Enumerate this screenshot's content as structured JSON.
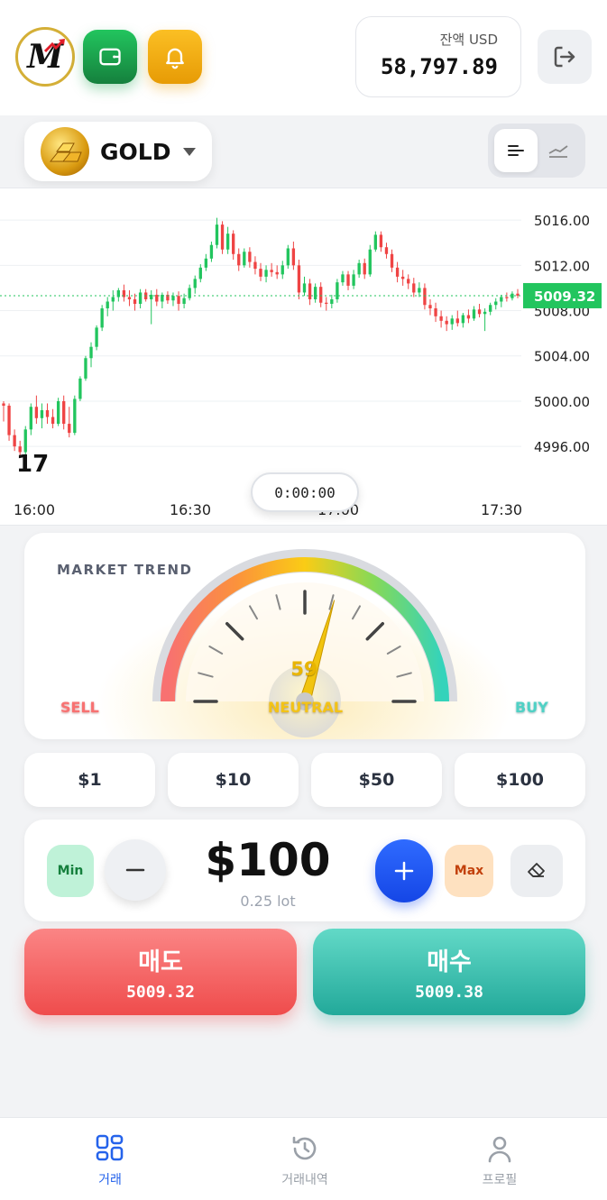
{
  "header": {
    "logo_letter": "M",
    "wallet_icon": "wallet-icon",
    "bell_icon": "bell-icon",
    "balance_label": "잔액 USD",
    "balance_value": "58,797.89",
    "logout_icon": "logout-icon"
  },
  "symbol": {
    "name": "GOLD",
    "icon": "gold-bars-icon"
  },
  "chart_data": {
    "type": "candlestick",
    "xlabels": [
      "16:00",
      "16:30",
      "17:00",
      "17:30"
    ],
    "yticks": [
      "5016.00",
      "5012.00",
      "5008.00",
      "5004.00",
      "5000.00",
      "4996.00"
    ],
    "ylim": [
      4994.5,
      5018.0
    ],
    "current_price": "5009.32",
    "up_color": "#22c55e",
    "down_color": "#ef4444",
    "candles": [
      [
        4999.8,
        5000.0,
        4998.2,
        4999.6
      ],
      [
        4999.6,
        4999.8,
        4996.5,
        4997.0
      ],
      [
        4997.0,
        4997.5,
        4995.6,
        4996.0
      ],
      [
        4996.0,
        4996.5,
        4995.0,
        4995.5
      ],
      [
        4995.5,
        4997.8,
        4995.2,
        4997.5
      ],
      [
        4997.5,
        4999.8,
        4997.0,
        4999.5
      ],
      [
        4999.5,
        5000.5,
        4998.0,
        4998.5
      ],
      [
        4998.5,
        4999.8,
        4997.6,
        4999.2
      ],
      [
        4999.2,
        4999.8,
        4998.0,
        4998.6
      ],
      [
        4998.6,
        4999.3,
        4997.6,
        4998.0
      ],
      [
        4998.0,
        5000.3,
        4997.8,
        5000.0
      ],
      [
        5000.0,
        5000.5,
        4997.5,
        4998.0
      ],
      [
        4998.0,
        4999.5,
        4996.8,
        4997.2
      ],
      [
        4997.2,
        5000.5,
        4997.0,
        5000.2
      ],
      [
        5000.2,
        5002.2,
        5000.0,
        5002.0
      ],
      [
        5002.0,
        5004.0,
        5001.8,
        5003.8
      ],
      [
        5003.8,
        5005.2,
        5003.0,
        5004.8
      ],
      [
        5004.8,
        5006.7,
        5004.5,
        5006.5
      ],
      [
        5006.5,
        5008.5,
        5006.2,
        5008.2
      ],
      [
        5008.2,
        5009.2,
        5007.5,
        5008.8
      ],
      [
        5008.8,
        5009.8,
        5008.0,
        5009.2
      ],
      [
        5009.2,
        5010.0,
        5008.8,
        5009.8
      ],
      [
        5009.8,
        5010.3,
        5008.8,
        5009.2
      ],
      [
        5009.2,
        5009.8,
        5008.4,
        5009.0
      ],
      [
        5009.0,
        5009.5,
        5008.0,
        5008.6
      ],
      [
        5008.6,
        5009.9,
        5008.2,
        5009.6
      ],
      [
        5009.6,
        5009.9,
        5008.8,
        5009.0
      ],
      [
        5009.0,
        5009.8,
        5006.8,
        5009.4
      ],
      [
        5009.4,
        5009.9,
        5008.4,
        5008.8
      ],
      [
        5008.8,
        5009.6,
        5008.2,
        5009.4
      ],
      [
        5009.4,
        5009.7,
        5008.6,
        5008.9
      ],
      [
        5008.9,
        5009.6,
        5008.4,
        5009.3
      ],
      [
        5009.3,
        5009.7,
        5008.0,
        5008.6
      ],
      [
        5008.6,
        5009.5,
        5008.2,
        5009.1
      ],
      [
        5009.1,
        5010.3,
        5008.9,
        5010.0
      ],
      [
        5010.0,
        5011.1,
        5009.5,
        5010.8
      ],
      [
        5010.8,
        5012.1,
        5010.5,
        5011.8
      ],
      [
        5011.8,
        5013.0,
        5011.5,
        5012.6
      ],
      [
        5012.6,
        5014.1,
        5012.3,
        5013.8
      ],
      [
        5013.8,
        5016.2,
        5013.5,
        5015.6
      ],
      [
        5015.6,
        5015.9,
        5013.0,
        5013.4
      ],
      [
        5013.4,
        5015.4,
        5013.0,
        5014.8
      ],
      [
        5014.8,
        5015.1,
        5012.5,
        5013.0
      ],
      [
        5013.0,
        5013.5,
        5011.5,
        5012.0
      ],
      [
        5012.0,
        5013.5,
        5011.8,
        5013.2
      ],
      [
        5013.2,
        5013.6,
        5011.8,
        5012.3
      ],
      [
        5012.3,
        5012.8,
        5011.2,
        5011.7
      ],
      [
        5011.7,
        5012.2,
        5010.6,
        5011.0
      ],
      [
        5011.0,
        5012.0,
        5010.5,
        5011.6
      ],
      [
        5011.6,
        5012.2,
        5011.0,
        5011.4
      ],
      [
        5011.4,
        5012.0,
        5010.8,
        5011.2
      ],
      [
        5011.2,
        5012.4,
        5010.8,
        5012.0
      ],
      [
        5012.0,
        5013.8,
        5011.7,
        5013.5
      ],
      [
        5013.5,
        5014.1,
        5011.6,
        5012.0
      ],
      [
        5012.0,
        5012.5,
        5009.0,
        5009.6
      ],
      [
        5009.6,
        5011.0,
        5009.3,
        5010.4
      ],
      [
        5010.4,
        5010.8,
        5008.5,
        5009.0
      ],
      [
        5009.0,
        5010.4,
        5008.7,
        5010.1
      ],
      [
        5010.1,
        5010.5,
        5008.3,
        5008.7
      ],
      [
        5008.7,
        5009.2,
        5008.0,
        5008.6
      ],
      [
        5008.6,
        5009.4,
        5008.2,
        5009.0
      ],
      [
        5009.0,
        5010.8,
        5008.7,
        5010.5
      ],
      [
        5010.5,
        5011.5,
        5010.2,
        5011.2
      ],
      [
        5011.2,
        5011.5,
        5009.8,
        5010.2
      ],
      [
        5010.2,
        5011.6,
        5009.9,
        5011.2
      ],
      [
        5011.2,
        5012.5,
        5010.9,
        5012.2
      ],
      [
        5012.2,
        5012.6,
        5010.8,
        5011.2
      ],
      [
        5011.2,
        5013.8,
        5011.0,
        5013.4
      ],
      [
        5013.4,
        5015.0,
        5013.2,
        5014.7
      ],
      [
        5014.7,
        5015.0,
        5013.2,
        5013.6
      ],
      [
        5013.6,
        5014.0,
        5012.6,
        5013.0
      ],
      [
        5013.0,
        5013.4,
        5011.4,
        5011.8
      ],
      [
        5011.8,
        5012.3,
        5010.5,
        5011.0
      ],
      [
        5011.0,
        5011.6,
        5010.2,
        5010.8
      ],
      [
        5010.8,
        5011.2,
        5009.9,
        5010.4
      ],
      [
        5010.4,
        5010.9,
        5009.2,
        5009.6
      ],
      [
        5009.6,
        5010.5,
        5009.2,
        5010.0
      ],
      [
        5010.0,
        5010.4,
        5008.1,
        5008.5
      ],
      [
        5008.5,
        5009.0,
        5007.6,
        5008.2
      ],
      [
        5008.2,
        5008.7,
        5007.0,
        5007.5
      ],
      [
        5007.5,
        5008.0,
        5006.5,
        5007.1
      ],
      [
        5007.1,
        5007.5,
        5006.2,
        5006.8
      ],
      [
        5006.8,
        5007.6,
        5006.3,
        5007.3
      ],
      [
        5007.3,
        5008.0,
        5006.6,
        5006.9
      ],
      [
        5006.9,
        5007.8,
        5006.5,
        5007.6
      ],
      [
        5007.6,
        5008.1,
        5006.9,
        5007.3
      ],
      [
        5007.3,
        5008.4,
        5007.1,
        5008.1
      ],
      [
        5008.1,
        5008.6,
        5007.4,
        5007.7
      ],
      [
        5007.7,
        5008.2,
        5006.2,
        5007.9
      ],
      [
        5007.9,
        5008.7,
        5007.6,
        5008.5
      ],
      [
        5008.5,
        5009.1,
        5008.1,
        5008.8
      ],
      [
        5008.8,
        5009.4,
        5008.3,
        5009.2
      ],
      [
        5009.2,
        5009.6,
        5008.8,
        5009.1
      ],
      [
        5009.1,
        5009.7,
        5008.9,
        5009.5
      ],
      [
        5009.5,
        5009.9,
        5009.1,
        5009.32
      ]
    ]
  },
  "timer": "0:00:00",
  "trend": {
    "title": "MARKET TREND",
    "value": "59",
    "percent": 59,
    "sell_label": "SELL",
    "neutral_label": "NEUTRAL",
    "buy_label": "BUY"
  },
  "quick_amounts": [
    "$1",
    "$10",
    "$50",
    "$100"
  ],
  "amount": {
    "min_label": "Min",
    "max_label": "Max",
    "value": "$100",
    "lot": "0.25 lot",
    "minus_icon": "minus-icon",
    "plus_icon": "plus-icon",
    "clear_icon": "eraser-icon"
  },
  "trade": {
    "sell_label": "매도",
    "sell_price": "5009.32",
    "buy_label": "매수",
    "buy_price": "5009.38",
    "sell_color": "#ef4c4c",
    "buy_color": "#22a99a"
  },
  "nav": {
    "items": [
      {
        "label": "거래",
        "icon": "grid-icon"
      },
      {
        "label": "거래내역",
        "icon": "history-icon"
      },
      {
        "label": "프로필",
        "icon": "user-icon"
      }
    ]
  }
}
